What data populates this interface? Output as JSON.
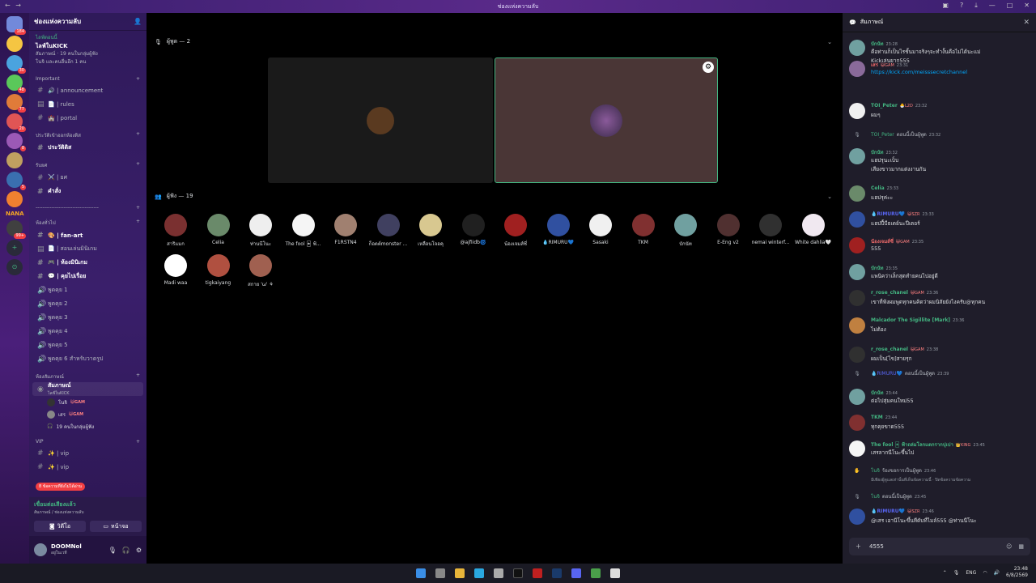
{
  "window": {
    "title": "ช่องแห่งความลับ"
  },
  "servers": [
    {
      "color": "#7289da",
      "badge": "184"
    },
    {
      "color": "#f5c542",
      "badge": ""
    },
    {
      "color": "#4aa3df",
      "badge": "30"
    },
    {
      "color": "#5ac85a",
      "badge": "48"
    },
    {
      "color": "#e07b39",
      "badge": "77"
    },
    {
      "color": "#e05555",
      "badge": "20"
    },
    {
      "color": "#9b59b6",
      "badge": "8"
    },
    {
      "color": "#c0a060",
      "badge": ""
    },
    {
      "color": "#3a6fb0",
      "badge": "5"
    },
    {
      "color": "#f08030",
      "badge": ""
    },
    {
      "color": "#404040",
      "badge": "99+"
    }
  ],
  "server_text_logo": "NANA",
  "sidebar": {
    "server_name": "ช่องแห่งความลับ",
    "event": {
      "live_label": "ไลฟ์ตอนนี้",
      "title": "ไลฟ์ในKICK",
      "meta": "สัมภาษณ์ · 19 คนในกลุ่มผู้ฟัง",
      "users": "โนจิ และคนอื่นอีก 1 คน"
    },
    "categories": [
      {
        "name": "Important",
        "channels": [
          {
            "icon": "#",
            "label": "🔊 | announcement",
            "bold": false
          },
          {
            "icon": "▤",
            "label": "📄 | rules",
            "bold": false
          },
          {
            "icon": "#",
            "label": "🏰 | portal",
            "bold": false
          }
        ]
      },
      {
        "name": "ประวัติเข้าออกห้องดิส",
        "channels": [
          {
            "icon": "#",
            "label": "ประวัติดิส",
            "bold": true
          }
        ]
      },
      {
        "name": "รับยศ",
        "channels": [
          {
            "icon": "#",
            "label": "⚔️ | ยศ",
            "bold": false
          },
          {
            "icon": "#",
            "label": "คำสั่ง",
            "bold": true
          }
        ]
      },
      {
        "name": "------------------------------------",
        "channels": []
      },
      {
        "name": "ห้องทั่วไป",
        "channels": [
          {
            "icon": "#",
            "label": "🎨 | fan-art",
            "bold": true
          },
          {
            "icon": "▤",
            "label": "📄 | สอนเล่นมินิเกม",
            "bold": false
          },
          {
            "icon": "#",
            "label": "🎮 | ห้องมินิเกม",
            "bold": true
          },
          {
            "icon": "#",
            "label": "💬 | คุยไปเรื่อย",
            "bold": true
          },
          {
            "icon": "🔊",
            "label": "พูดคุย 1",
            "bold": false
          },
          {
            "icon": "🔊",
            "label": "พูดคุย 2",
            "bold": false
          },
          {
            "icon": "🔊",
            "label": "พูดคุย 3",
            "bold": false
          },
          {
            "icon": "🔊",
            "label": "พูดคุย 4",
            "bold": false
          },
          {
            "icon": "🔊",
            "label": "พูดคุย 5",
            "bold": false
          },
          {
            "icon": "🔊",
            "label": "พูดคุย 6 สำหรับวาดรูป",
            "bold": false
          }
        ]
      }
    ],
    "interview_category": "ห้องสัมภาษณ์",
    "active_channel": {
      "label": "สัมภาษณ์",
      "sub": "ไลฟ์ในKICK"
    },
    "voice_users": [
      {
        "name": "โนจิ",
        "tag": "😺GAM",
        "color": "#333"
      },
      {
        "name": "เสร",
        "tag": "😺GAM",
        "color": "#888"
      }
    ],
    "listeners_line": "19 คนในกลุ่มผู้ฟัง",
    "vip_category": "VIP",
    "vip_channels": [
      "✨ | vip",
      "✨ | vip"
    ],
    "unread_pill": "ข้อความที่ยังไม่ได้อ่าน",
    "unread_count": "8"
  },
  "voice_panel": {
    "status": "เชื่อมต่อเสียงแล้ว",
    "sub": "สัมภาษณ์ / ช่องแห่งความลับ",
    "video_btn": "วิดีโอ",
    "screen_btn": "หน้าจอ"
  },
  "user_panel": {
    "name": "DOOMNol",
    "status": "อยู่ในเวที"
  },
  "stage": {
    "speakers_header": "ผู้พูด — 2",
    "audience_header": "ผู้ฟัง — 19",
    "audience": [
      {
        "name": "สาริแมก",
        "color": "#7a3030"
      },
      {
        "name": "Celia",
        "color": "#6a8a6a"
      },
      {
        "name": "ท่านนีโนะ",
        "color": "#eeeeee"
      },
      {
        "name": "The fool 🃏 ฟ้...",
        "color": "#f5f5f5"
      },
      {
        "name": "F1RSTN4",
        "color": "#a08070"
      },
      {
        "name": "ก็อตต์monster ...",
        "color": "#404060"
      },
      {
        "name": "เหลือนโจอคุ",
        "color": "#d8c890"
      },
      {
        "name": "@ajfiidb🌀",
        "color": "#202020"
      },
      {
        "name": "น้องเจมส์ซี่",
        "color": "#a02020"
      },
      {
        "name": "💧RIMURU💙",
        "color": "#3050a0"
      },
      {
        "name": "Sasaki",
        "color": "#f0f0f0"
      },
      {
        "name": "TKM",
        "color": "#803030"
      },
      {
        "name": "บักนัท",
        "color": "#70a0a0"
      },
      {
        "name": "E-Eng v2",
        "color": "#503030"
      },
      {
        "name": "nemai winterf...",
        "color": "#303030"
      },
      {
        "name": "White dahlia🤍",
        "color": "#f0e8f0"
      },
      {
        "name": "Madi waa",
        "color": "#ffffff"
      },
      {
        "name": "tigkaiyang",
        "color": "#b05040"
      },
      {
        "name": "สกาย 'ω' ⚘",
        "color": "#a06050"
      }
    ]
  },
  "chat": {
    "title": "สัมภาษณ์",
    "input_value": "4555",
    "messages": [
      {
        "type": "msg",
        "name": "บักนัท",
        "color": "#43b581",
        "time": "23:28",
        "badge": "",
        "avatar": "#70a0a0",
        "text": "คือท่านก็เป็นไรชั้นมาจริงๆจะทำงั้นคือไม่ได้นะแม่",
        "text2": "Kickเล่นยาก555"
      },
      {
        "type": "msg",
        "name": "เสร",
        "color": "#f06a6a",
        "time": "23:31",
        "badge": "😺GAM",
        "avatar": "#8a6a9a",
        "text": "https://kick.com/meisssecretchannel",
        "text2": "",
        "link": true
      },
      {
        "type": "msg",
        "name": "TOI_Peter",
        "color": "#43b581",
        "time": "23:32",
        "badge": "🐣L2D",
        "avatar": "#f0f0f0",
        "text": "ผมๆ",
        "text2": ""
      },
      {
        "type": "sys",
        "name": "TOI_Peter",
        "color": "#43b581",
        "text": "ตอนนี้เป็นผู้พูด",
        "time": "23:32"
      },
      {
        "type": "msg",
        "name": "บักนัท",
        "color": "#43b581",
        "time": "23:32",
        "badge": "",
        "avatar": "#70a0a0",
        "text": "แฮปรุนะเบ็บ",
        "text2": "เสียงขาวมากแต่งงานกัน"
      },
      {
        "type": "msg",
        "name": "Celia",
        "color": "#43b581",
        "time": "23:33",
        "badge": "",
        "avatar": "#6a8a6a",
        "text": "แฮปรุค่ะะ",
        "text2": ""
      },
      {
        "type": "msg",
        "name": "💧RIMURU💙",
        "color": "#5865f2",
        "time": "23:33",
        "badge": "😺SZR",
        "avatar": "#3050a0",
        "text": "แฮปปี้บีธเดย์นะปีเตอร์",
        "text2": ""
      },
      {
        "type": "msg",
        "name": "น้องเจมส์ซี่",
        "color": "#f06a6a",
        "time": "23:35",
        "badge": "😺GAM",
        "avatar": "#a02020",
        "text": "555",
        "text2": ""
      },
      {
        "type": "msg",
        "name": "บักนัท",
        "color": "#43b581",
        "time": "23:35",
        "badge": "",
        "avatar": "#70a0a0",
        "text": "แพนิคว่าเล็กสุดทำยคนไปอยู่ดี",
        "text2": ""
      },
      {
        "type": "msg",
        "name": "r_rose_chanel",
        "color": "#43b581",
        "time": "23:36",
        "badge": "😺GAM",
        "avatar": "#303030",
        "text": "เขาที่ฟังผมพูดทุกคนคิดว่าผมนิสัยยังไงครับ@ทุกคน",
        "text2": ""
      },
      {
        "type": "msg",
        "name": "Malcador The Sigillite [Mark]",
        "color": "#43b581",
        "time": "23:36",
        "badge": "",
        "avatar": "#c08040",
        "text": "ไม่ต้อง",
        "text2": ""
      },
      {
        "type": "msg",
        "name": "r_rose_chanel",
        "color": "#43b581",
        "time": "23:38",
        "badge": "😺GAM",
        "avatar": "#303030",
        "text": "ผมเป็น[ไข]สายรุก",
        "text2": ""
      },
      {
        "type": "sys",
        "name": "💧RIMURU💙",
        "color": "#5865f2",
        "text": "ตอนนี้เป็นผู้พูด",
        "time": "23:39"
      },
      {
        "type": "msg",
        "name": "บักนัท",
        "color": "#43b581",
        "time": "23:44",
        "badge": "",
        "avatar": "#70a0a0",
        "text": "ต่อไปสุ่มคนใหม่55",
        "text2": ""
      },
      {
        "type": "msg",
        "name": "TKM",
        "color": "#43b581",
        "time": "23:44",
        "badge": "",
        "avatar": "#803030",
        "text": "ทุกคุยขาด555",
        "text2": ""
      },
      {
        "type": "msg",
        "name": "The fool 🃏 ฟ้าถล่มโลกแตกรากปุเปา",
        "color": "#43b581",
        "time": "23:45",
        "badge": "👑KING",
        "avatar": "#f5f5f5",
        "text": "เสรลากนีโนะขึ้นไป",
        "text2": ""
      },
      {
        "type": "sys",
        "name": "โนจิ",
        "color": "#43b581",
        "text": "ร้องขอการเป็นผู้พูด",
        "time": "23:46",
        "sub": "มีเพียงผู้ดูแลเท่านั้นที่เห็นข้อความนี้ · ปิดข้อความข้อความ"
      },
      {
        "type": "sys",
        "name": "โนจิ",
        "color": "#43b581",
        "text": "ตอนนี้เป็นผู้พูด",
        "time": "23:45"
      },
      {
        "type": "msg",
        "name": "💧RIMURU💙",
        "color": "#5865f2",
        "time": "23:46",
        "badge": "😺SZR",
        "avatar": "#3050a0",
        "text": "@เสร เอานีโนะขึ้นทีดับที่ไมล์555 @ท่านนีโนะ",
        "text2": ""
      }
    ]
  },
  "taskbar": {
    "lang": "ENG",
    "time": "23:48",
    "date": "6/8/2569"
  }
}
